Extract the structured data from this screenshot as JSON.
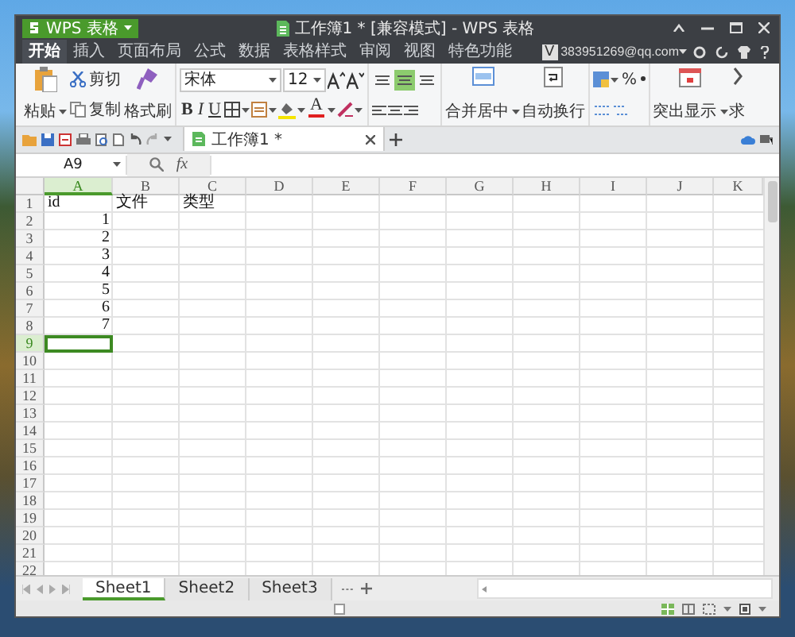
{
  "window": {
    "app_button": "WPS 表格",
    "title": "工作簿1 * [兼容模式] - WPS 表格"
  },
  "menu_tabs": [
    {
      "label": "开始",
      "selected": true
    },
    {
      "label": "插入",
      "selected": false
    },
    {
      "label": "页面布局",
      "selected": false
    },
    {
      "label": "公式",
      "selected": false
    },
    {
      "label": "数据",
      "selected": false
    },
    {
      "label": "表格样式",
      "selected": false
    },
    {
      "label": "审阅",
      "selected": false
    },
    {
      "label": "视图",
      "selected": false
    },
    {
      "label": "特色功能",
      "selected": false
    }
  ],
  "account": {
    "badge": "V",
    "email": "383951269@qq.com"
  },
  "ribbon": {
    "paste": "粘贴",
    "cut": "剪切",
    "copy": "复制",
    "format_painter": "格式刷",
    "font_name": "宋体",
    "font_size": "12",
    "bold": "B",
    "italic": "I",
    "underline": "U",
    "font_color": "A",
    "align_buttons": [
      {
        "selected": false
      },
      {
        "selected": true
      },
      {
        "selected": false
      }
    ],
    "merge_center": "合并居中",
    "wrap_text": "自动换行",
    "percent": "%",
    "highlight": "突出显示",
    "cut_off_button": "求"
  },
  "document_tabs": [
    {
      "label": "工作簿1 *",
      "selected": true
    }
  ],
  "formula_bar": {
    "name_box": "A9",
    "fx": "fx"
  },
  "sheet": {
    "columns": [
      {
        "label": "A",
        "selected": true
      },
      {
        "label": "B",
        "selected": false
      },
      {
        "label": "C",
        "selected": false
      },
      {
        "label": "D",
        "selected": false
      },
      {
        "label": "E",
        "selected": false
      },
      {
        "label": "F",
        "selected": false
      },
      {
        "label": "G",
        "selected": false
      },
      {
        "label": "H",
        "selected": false
      },
      {
        "label": "I",
        "selected": false
      },
      {
        "label": "J",
        "selected": false
      },
      {
        "label": "K",
        "selected": false
      }
    ],
    "rows": [
      {
        "header": "1",
        "selected": false,
        "cells": [
          {
            "kind": "text",
            "value": "id"
          },
          {
            "kind": "text",
            "value": "文件"
          },
          {
            "kind": "text",
            "value": "类型"
          }
        ]
      },
      {
        "header": "2",
        "selected": false,
        "cells": [
          {
            "kind": "number",
            "value": "1"
          }
        ]
      },
      {
        "header": "3",
        "selected": false,
        "cells": [
          {
            "kind": "number",
            "value": "2"
          }
        ]
      },
      {
        "header": "4",
        "selected": false,
        "cells": [
          {
            "kind": "number",
            "value": "3"
          }
        ]
      },
      {
        "header": "5",
        "selected": false,
        "cells": [
          {
            "kind": "number",
            "value": "4"
          }
        ]
      },
      {
        "header": "6",
        "selected": false,
        "cells": [
          {
            "kind": "number",
            "value": "5"
          }
        ]
      },
      {
        "header": "7",
        "selected": false,
        "cells": [
          {
            "kind": "number",
            "value": "6"
          }
        ]
      },
      {
        "header": "8",
        "selected": false,
        "cells": [
          {
            "kind": "number",
            "value": "7"
          }
        ]
      },
      {
        "header": "9",
        "selected": true
      },
      {
        "header": "10",
        "selected": false
      },
      {
        "header": "11",
        "selected": false
      },
      {
        "header": "12",
        "selected": false
      },
      {
        "header": "13",
        "selected": false
      },
      {
        "header": "14",
        "selected": false
      },
      {
        "header": "15",
        "selected": false
      },
      {
        "header": "16",
        "selected": false
      },
      {
        "header": "17",
        "selected": false
      },
      {
        "header": "18",
        "selected": false
      },
      {
        "header": "19",
        "selected": false
      },
      {
        "header": "20",
        "selected": false
      },
      {
        "header": "21",
        "selected": false
      },
      {
        "header": "22",
        "selected": false
      }
    ]
  },
  "sheet_tabs": [
    {
      "label": "Sheet1",
      "selected": true
    },
    {
      "label": "Sheet2",
      "selected": false
    },
    {
      "label": "Sheet3",
      "selected": false
    }
  ]
}
